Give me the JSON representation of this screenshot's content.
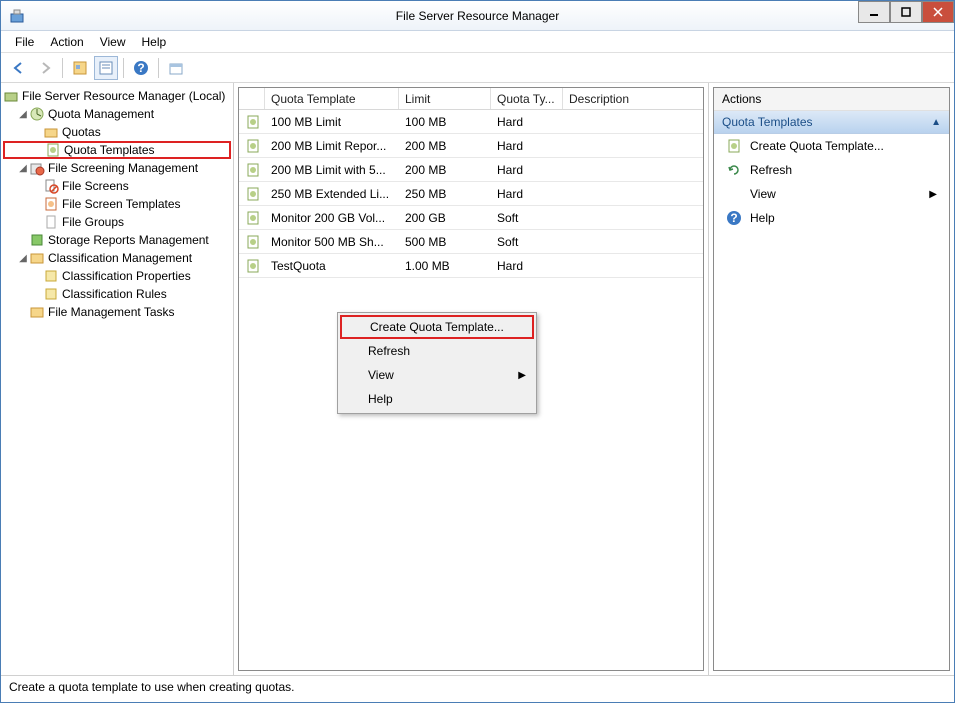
{
  "window": {
    "title": "File Server Resource Manager"
  },
  "menu": {
    "file": "File",
    "action": "Action",
    "view": "View",
    "help": "Help"
  },
  "tree": {
    "root": "File Server Resource Manager (Local)",
    "quota_mgmt": "Quota Management",
    "quotas": "Quotas",
    "quota_templates": "Quota Templates",
    "file_screening": "File Screening Management",
    "file_screens": "File Screens",
    "file_screen_templates": "File Screen Templates",
    "file_groups": "File Groups",
    "storage_reports": "Storage Reports Management",
    "classification_mgmt": "Classification Management",
    "classification_props": "Classification Properties",
    "classification_rules": "Classification Rules",
    "file_mgmt_tasks": "File Management Tasks"
  },
  "list": {
    "headers": {
      "template": "Quota Template",
      "limit": "Limit",
      "type": "Quota Ty...",
      "desc": "Description"
    },
    "rows": [
      {
        "name": "100 MB Limit",
        "limit": "100 MB",
        "type": "Hard",
        "desc": ""
      },
      {
        "name": "200 MB Limit Repor...",
        "limit": "200 MB",
        "type": "Hard",
        "desc": ""
      },
      {
        "name": "200 MB Limit with 5...",
        "limit": "200 MB",
        "type": "Hard",
        "desc": ""
      },
      {
        "name": "250 MB Extended Li...",
        "limit": "250 MB",
        "type": "Hard",
        "desc": ""
      },
      {
        "name": "Monitor 200 GB Vol...",
        "limit": "200 GB",
        "type": "Soft",
        "desc": ""
      },
      {
        "name": "Monitor 500 MB Sh...",
        "limit": "500 MB",
        "type": "Soft",
        "desc": ""
      },
      {
        "name": "TestQuota",
        "limit": "1.00 MB",
        "type": "Hard",
        "desc": ""
      }
    ]
  },
  "contextmenu": {
    "create": "Create Quota Template...",
    "refresh": "Refresh",
    "view": "View",
    "help": "Help"
  },
  "actions": {
    "header": "Actions",
    "title": "Quota Templates",
    "create": "Create Quota Template...",
    "refresh": "Refresh",
    "view": "View",
    "help": "Help"
  },
  "status": "Create a quota template to use when creating quotas."
}
